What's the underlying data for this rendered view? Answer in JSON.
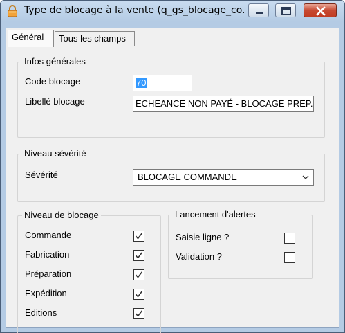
{
  "window": {
    "title": "Type de blocage à la vente (q_gs_blocage_co..."
  },
  "tabs": [
    "Général",
    "Tous les champs"
  ],
  "infos_generales": {
    "title": "Infos générales",
    "code_label": "Code blocage",
    "code_value": "70",
    "libelle_label": "Libellé blocage",
    "libelle_value": "ECHEANCE NON PAYÉ - BLOCAGE PREP."
  },
  "niveau_severite": {
    "title": "Niveau sévérité",
    "severite_label": "Sévérité",
    "severite_value": "BLOCAGE COMMANDE"
  },
  "niveau_blocage": {
    "title": "Niveau de blocage",
    "items": [
      {
        "label": "Commande",
        "checked": true
      },
      {
        "label": "Fabrication",
        "checked": true
      },
      {
        "label": "Préparation",
        "checked": true
      },
      {
        "label": "Expédition",
        "checked": true
      },
      {
        "label": "Editions",
        "checked": true
      }
    ]
  },
  "lancement_alertes": {
    "title": "Lancement d'alertes",
    "items": [
      {
        "label": "Saisie ligne ?",
        "checked": false
      },
      {
        "label": "Validation ?",
        "checked": false
      }
    ]
  },
  "icons": {
    "lock": "lock-icon",
    "minimize": "minimize-icon",
    "maximize": "maximize-icon",
    "close": "close-icon",
    "dropdown": "chevron-down-icon",
    "check": "checkmark-icon"
  }
}
